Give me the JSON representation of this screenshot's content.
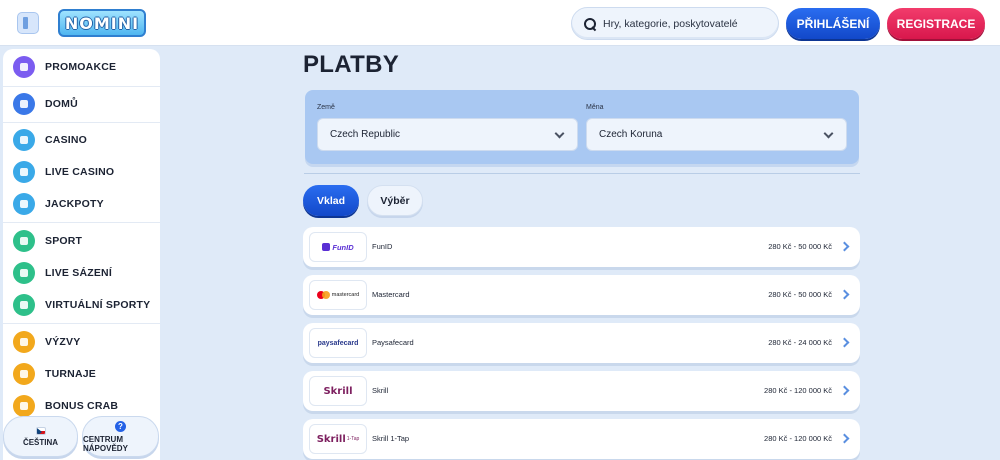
{
  "header": {
    "logo_text": "NOMINI",
    "search_placeholder": "Hry, kategorie, poskytovatelé",
    "login_label": "PŘIHLÁŠENÍ",
    "register_label": "REGISTRACE"
  },
  "sidebar": {
    "items": [
      {
        "label": "PROMOAKCE",
        "icon": "gift-icon",
        "color": "#7b5cf0"
      },
      {
        "label": "DOMŮ",
        "icon": "home-icon",
        "color": "#3a78e8"
      },
      {
        "label": "CASINO",
        "icon": "cherries-icon",
        "color": "#3aa9e8"
      },
      {
        "label": "LIVE CASINO",
        "icon": "cards-icon",
        "color": "#3aa9e8"
      },
      {
        "label": "JACKPOTY",
        "icon": "jackpot-icon",
        "color": "#3aa9e8"
      },
      {
        "label": "SPORT",
        "icon": "ball-icon",
        "color": "#2ec08a"
      },
      {
        "label": "LIVE SÁZENÍ",
        "icon": "live-tv-icon",
        "color": "#2ec08a"
      },
      {
        "label": "VIRTUÁLNÍ SPORTY",
        "icon": "monitor-icon",
        "color": "#2ec08a"
      },
      {
        "label": "VÝZVY",
        "icon": "target-icon",
        "color": "#f2a81c"
      },
      {
        "label": "TURNAJE",
        "icon": "trophy-icon",
        "color": "#f2a81c"
      },
      {
        "label": "BONUS CRAB",
        "icon": "crab-icon",
        "color": "#f2a81c"
      }
    ],
    "language_label": "ČEŠTINA",
    "help_label": "CENTRUM NÁPOVĚDY"
  },
  "main": {
    "title": "PLATBY",
    "country_label": "Země",
    "country_value": "Czech Republic",
    "currency_label": "Měna",
    "currency_value": "Czech Koruna",
    "tab_deposit": "Vklad",
    "tab_withdraw": "Výběr",
    "methods": [
      {
        "name": "FunID",
        "range": "280 Kč - 50 000 Kč",
        "logo_text": "FunID"
      },
      {
        "name": "Mastercard",
        "range": "280 Kč - 50 000 Kč",
        "logo_text": "mastercard"
      },
      {
        "name": "Paysafecard",
        "range": "280 Kč - 24 000 Kč",
        "logo_text": "paysafecard"
      },
      {
        "name": "Skrill",
        "range": "280 Kč - 120 000 Kč",
        "logo_text": "Skrill"
      },
      {
        "name": "Skrill 1-Tap",
        "range": "280 Kč - 120 000 Kč",
        "logo_text": "Skrill",
        "logo_sub": "1-Tap"
      }
    ]
  }
}
